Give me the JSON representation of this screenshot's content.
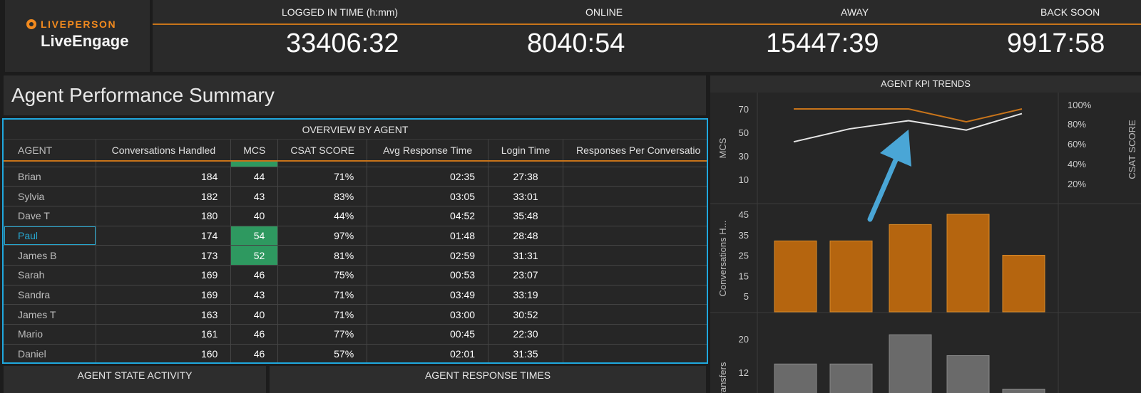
{
  "brand": {
    "company": "LIVEPERSON",
    "product": "LiveEngage"
  },
  "stats": [
    {
      "label": "LOGGED IN TIME (h:mm)",
      "value": "33406:32"
    },
    {
      "label": "ONLINE",
      "value": "8040:54"
    },
    {
      "label": "AWAY",
      "value": "15447:39"
    },
    {
      "label": "BACK SOON",
      "value": "9917:58"
    }
  ],
  "page_title": "Agent Performance Summary",
  "overview": {
    "title": "OVERVIEW BY AGENT",
    "columns": [
      "AGENT",
      "Conversations Handled",
      "MCS",
      "CSAT SCORE",
      "Avg Response Time",
      "Login Time",
      "Responses Per Conversatio"
    ],
    "rows": [
      {
        "agent": "Brian",
        "conversations": "184",
        "mcs": "44",
        "csat": "71%",
        "avg_response": "02:35",
        "login": "27:38",
        "highlight_mcs": false
      },
      {
        "agent": "Sylvia",
        "conversations": "182",
        "mcs": "43",
        "csat": "83%",
        "avg_response": "03:05",
        "login": "33:01",
        "highlight_mcs": false
      },
      {
        "agent": "Dave T",
        "conversations": "180",
        "mcs": "40",
        "csat": "44%",
        "avg_response": "04:52",
        "login": "35:48",
        "highlight_mcs": false
      },
      {
        "agent": "Paul",
        "conversations": "174",
        "mcs": "54",
        "csat": "97%",
        "avg_response": "01:48",
        "login": "28:48",
        "highlight_mcs": true,
        "selected": true
      },
      {
        "agent": "James B",
        "conversations": "173",
        "mcs": "52",
        "csat": "81%",
        "avg_response": "02:59",
        "login": "31:31",
        "highlight_mcs": true
      },
      {
        "agent": "Sarah",
        "conversations": "169",
        "mcs": "46",
        "csat": "75%",
        "avg_response": "00:53",
        "login": "23:07",
        "highlight_mcs": false
      },
      {
        "agent": "Sandra",
        "conversations": "169",
        "mcs": "43",
        "csat": "71%",
        "avg_response": "03:49",
        "login": "33:19",
        "highlight_mcs": false
      },
      {
        "agent": "James T",
        "conversations": "163",
        "mcs": "40",
        "csat": "71%",
        "avg_response": "03:00",
        "login": "30:52",
        "highlight_mcs": false
      },
      {
        "agent": "Mario",
        "conversations": "161",
        "mcs": "46",
        "csat": "77%",
        "avg_response": "00:45",
        "login": "22:30",
        "highlight_mcs": false
      },
      {
        "agent": "Daniel",
        "conversations": "160",
        "mcs": "46",
        "csat": "57%",
        "avg_response": "02:01",
        "login": "31:35",
        "highlight_mcs": false
      }
    ]
  },
  "bottom_panels": {
    "state_activity": "AGENT STATE ACTIVITY",
    "response_times": "AGENT RESPONSE TIMES"
  },
  "colors": {
    "accent": "#c8741a",
    "selection": "#1fa8de",
    "good": "#2e9960",
    "bar_orange": "#b5650f",
    "bar_gray": "#6a6a6a",
    "arrow": "#4aa6d6"
  },
  "chart_data": [
    {
      "type": "line",
      "title": "AGENT KPI TRENDS",
      "ylabel": "MCS",
      "ylabel_right": "CSAT SCORE",
      "yticks": [
        70,
        50,
        30,
        10
      ],
      "yticks_right": [
        "100%",
        "80%",
        "60%",
        "40%",
        "20%"
      ],
      "series": [
        {
          "values": [
            70,
            70,
            70,
            59,
            70
          ]
        },
        {
          "values": [
            42,
            53,
            60,
            52,
            66
          ]
        }
      ]
    },
    {
      "type": "bar",
      "ylabel": "Conversations H...",
      "yticks": [
        45,
        35,
        25,
        15,
        5
      ],
      "values": [
        32,
        32,
        40,
        45,
        25
      ]
    },
    {
      "type": "bar",
      "ylabel": "ransfers",
      "yticks": [
        20,
        12
      ],
      "values": [
        14,
        14,
        21,
        16,
        8
      ]
    }
  ],
  "annotation": {
    "icon": "arrow-icon"
  }
}
